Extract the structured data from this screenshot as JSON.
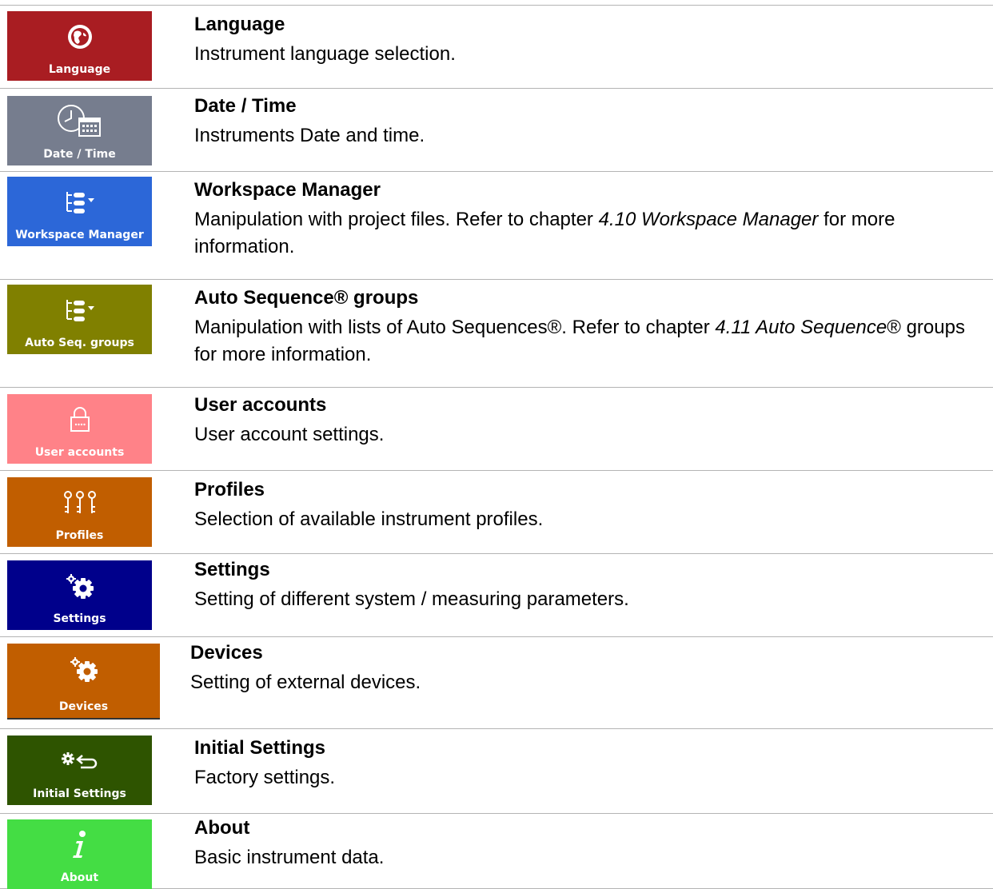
{
  "items": [
    {
      "tile_label": "Language",
      "tile_color": "#a91d22",
      "icon": "globe-icon",
      "title": "Language",
      "desc": "Instrument language selection."
    },
    {
      "tile_label": "Date / Time",
      "tile_color": "#767d8e",
      "icon": "clock-calendar-icon",
      "title": "Date / Time",
      "desc": "Instruments Date and time."
    },
    {
      "tile_label": "Workspace Manager",
      "tile_color": "#2c67d8",
      "icon": "tree-menu-icon",
      "title": "Workspace Manager",
      "desc_a": "Manipulation with project files. Refer to chapter ",
      "desc_ref": "4.10 Workspace Manager",
      "desc_b": " for more information."
    },
    {
      "tile_label": "Auto Seq. groups",
      "tile_color": "#808000",
      "icon": "tree-menu-icon",
      "title": "Auto Sequence® groups",
      "desc_a": "Manipulation with lists of Auto Sequences®. Refer to chapter ",
      "desc_ref": "4.11 Auto Sequence",
      "desc_b": "® groups for more information."
    },
    {
      "tile_label": "User accounts",
      "tile_color": "#ff8288",
      "icon": "padlock-icon",
      "title": "User accounts",
      "desc": "User account settings."
    },
    {
      "tile_label": "Profiles",
      "tile_color": "#c15e00",
      "icon": "keys-icon",
      "title": "Profiles",
      "desc": "Selection of available instrument profiles."
    },
    {
      "tile_label": "Settings",
      "tile_color": "#00008b",
      "icon": "gears-icon",
      "title": "Settings",
      "desc": "Setting of different system / measuring parameters."
    },
    {
      "tile_label": "Devices",
      "tile_color": "#c15e00",
      "icon": "gears-icon",
      "title": "Devices",
      "desc": "Setting of external devices."
    },
    {
      "tile_label": "Initial Settings",
      "tile_color": "#2e5400",
      "icon": "gear-return-icon",
      "title": "Initial Settings",
      "desc": "Factory settings."
    },
    {
      "tile_label": "About",
      "tile_color": "#44dd44",
      "icon": "info-icon",
      "title": "About",
      "desc": "Basic instrument data."
    }
  ]
}
